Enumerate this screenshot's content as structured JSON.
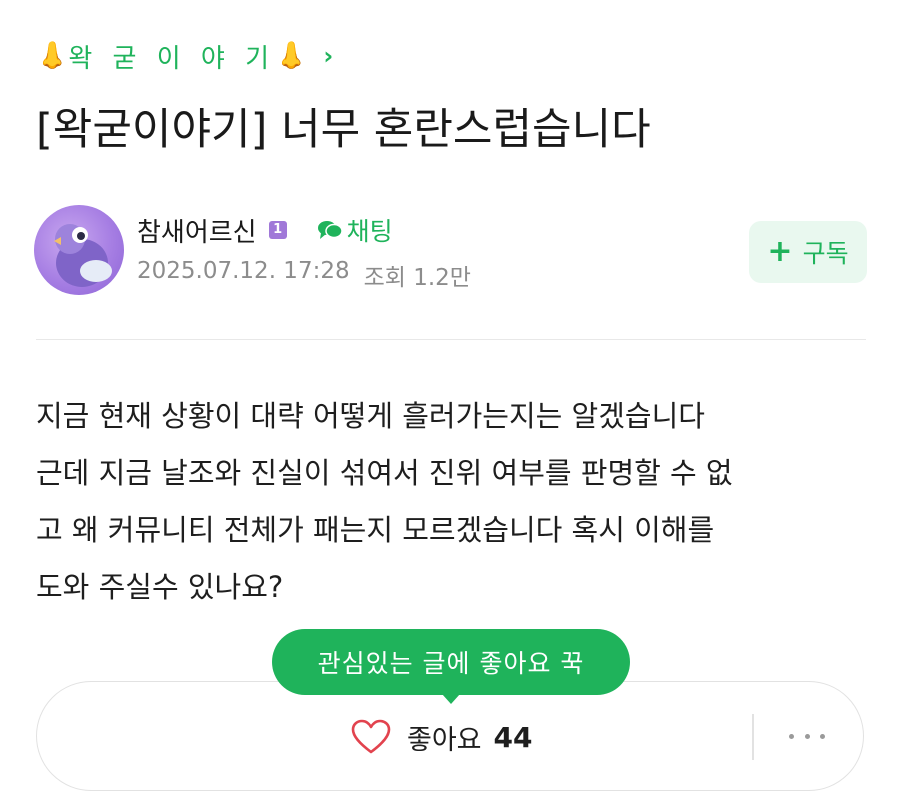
{
  "category": {
    "emoji": "👃",
    "label": "왁 굳 이 야 기",
    "chevron": "›"
  },
  "post": {
    "title": "[왁굳이야기] 너무 혼란스럽습니다",
    "author": "참새어르신",
    "level_badge": "1",
    "chat_label": "채팅",
    "date": "2025.07.12. 17:28",
    "views_label": "조회",
    "views": "1.2만",
    "subscribe_label": "구독",
    "body_lines": [
      "지금 현재 상황이 대략 어떻게 흘러가는지는 알겠습니다",
      "근데 지금 날조와 진실이 섞여서 진위 여부를 판명할 수 없",
      "고 왜 커뮤니티 전체가 패는지 모르겠습니다 혹시 이해를",
      "도와 주실수 있나요?"
    ]
  },
  "actions": {
    "tooltip": "관심있는 글에 좋아요 꾹",
    "like_label": "좋아요",
    "like_count": "44"
  },
  "colors": {
    "accent": "#1fb35b",
    "accent_bg": "#e9f8ef",
    "badge": "#a078d8",
    "meta_text": "#8c8c8c"
  },
  "icons": {
    "category": "nose-emoji",
    "chevron": "chevron-right-icon",
    "chat": "chat-bubble-icon",
    "subscribe": "plus-icon",
    "like": "heart-outline-icon",
    "more": "more-horizontal-icon"
  }
}
